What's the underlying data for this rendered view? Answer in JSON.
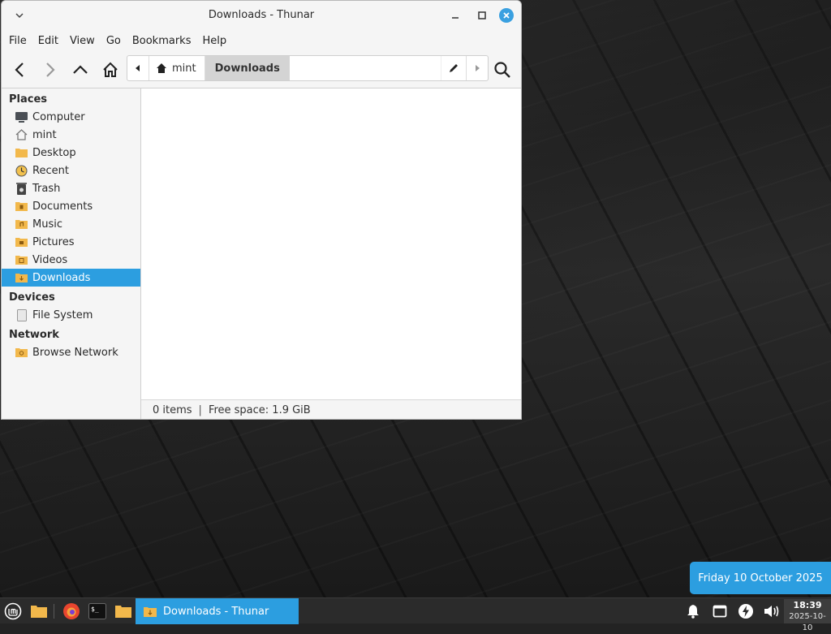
{
  "window": {
    "title": "Downloads - Thunar"
  },
  "menubar": {
    "items": [
      "File",
      "Edit",
      "View",
      "Go",
      "Bookmarks",
      "Help"
    ]
  },
  "pathbar": {
    "home_label": "mint",
    "current_label": "Downloads"
  },
  "sidebar": {
    "places_header": "Places",
    "places": [
      {
        "label": "Computer",
        "icon": "computer-icon"
      },
      {
        "label": "mint",
        "icon": "home-icon"
      },
      {
        "label": "Desktop",
        "icon": "folder-icon"
      },
      {
        "label": "Recent",
        "icon": "clock-icon"
      },
      {
        "label": "Trash",
        "icon": "trash-icon"
      },
      {
        "label": "Documents",
        "icon": "documents-folder-icon"
      },
      {
        "label": "Music",
        "icon": "music-folder-icon"
      },
      {
        "label": "Pictures",
        "icon": "pictures-folder-icon"
      },
      {
        "label": "Videos",
        "icon": "videos-folder-icon"
      },
      {
        "label": "Downloads",
        "icon": "downloads-folder-icon",
        "selected": true
      }
    ],
    "devices_header": "Devices",
    "devices": [
      {
        "label": "File System",
        "icon": "drive-icon"
      }
    ],
    "network_header": "Network",
    "network": [
      {
        "label": "Browse Network",
        "icon": "network-folder-icon"
      }
    ]
  },
  "statusbar": {
    "items": "0 items",
    "separator": "|",
    "free_space": "Free space: 1.9 GiB"
  },
  "taskbar": {
    "window_button_label": "Downloads - Thunar",
    "clock_time": "18:39",
    "clock_date": "2025-10-10"
  },
  "date_popup": {
    "text": "Friday 10 October 2025"
  },
  "colors": {
    "accent": "#2c9ee0",
    "folder": "#f2b84b",
    "taskbar": "#2b2b2b"
  }
}
